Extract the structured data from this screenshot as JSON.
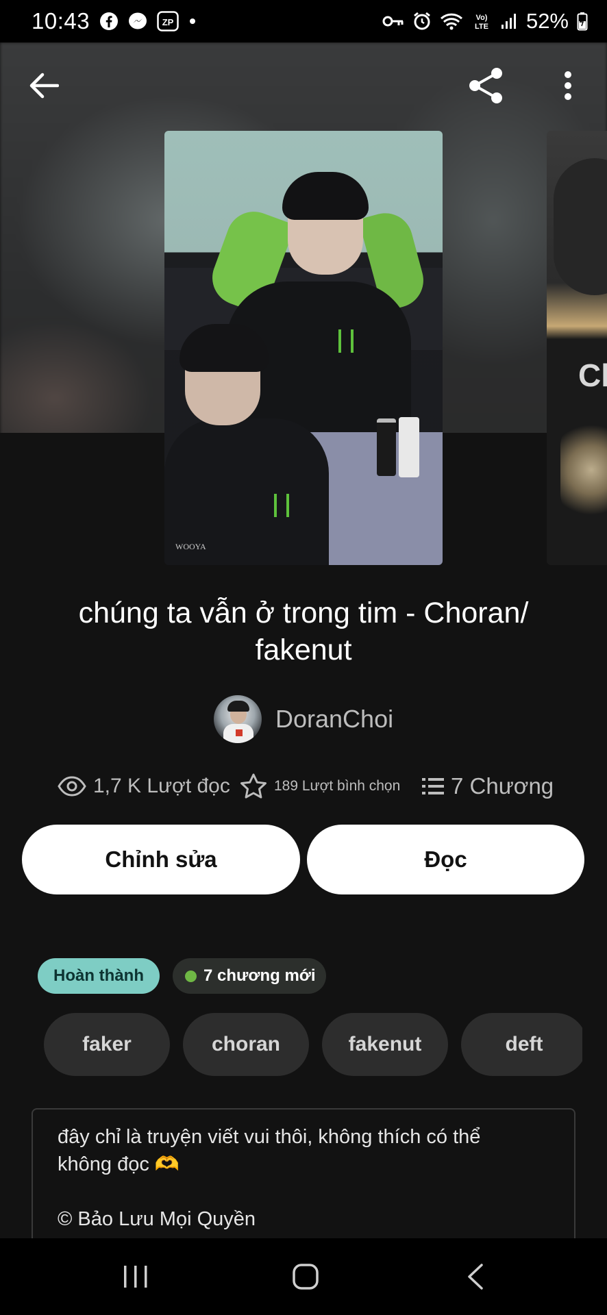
{
  "status_bar": {
    "time": "10:43",
    "zp_label": "ZP",
    "battery_text": "52%",
    "network_label": "Vo) LTE"
  },
  "icons": {
    "back": "arrow-left",
    "share": "share",
    "more": "more-vertical",
    "reads": "eye",
    "votes": "star",
    "parts": "list"
  },
  "story": {
    "title_line1": "chúng ta vẫn ở trong tim - Choran/",
    "title_line2": "fakenut",
    "author": "DoranChoi",
    "reads": "1,7 K Lượt đọc",
    "votes": "189 Lượt bình chọn",
    "parts": "7 Chương",
    "cover_watermark": "WOOYA",
    "next_cover_text": "Ch"
  },
  "actions": {
    "edit_label": "Chỉnh sửa",
    "read_label": "Đọc"
  },
  "badges": {
    "status": "Hoàn thành",
    "new_parts": "7 chương mới"
  },
  "tags": [
    "faker",
    "choran",
    "fakenut",
    "deft"
  ],
  "description": {
    "line1": "đây chỉ là truyện viết vui thôi, không thích có thể",
    "line2": "không đọc 🫶",
    "line3": "© Bảo Lưu Mọi Quyền"
  },
  "colors": {
    "background": "#121212",
    "badge_complete": "#7ecdc4",
    "new_dot": "#6fb845",
    "button_bg": "#ffffff",
    "tag_bg": "#2d2d2d"
  }
}
